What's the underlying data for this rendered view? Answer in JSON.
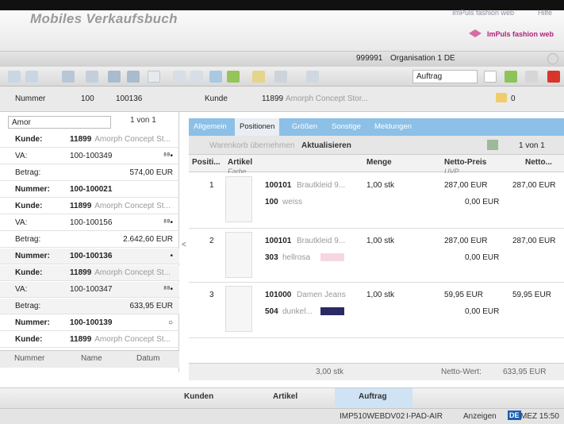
{
  "header": {
    "app_title": "Mobiles Verkaufsbuch",
    "brand_link": "ImPuls fashion web",
    "help_link": "Hilfe",
    "brand_text": "ImPuls fashion web",
    "org_code": "999991",
    "org_name": "Organisation 1 DE"
  },
  "toolbar": {
    "mode_value": "Auftrag"
  },
  "record_header": {
    "nummer_label": "Nummer",
    "nummer_short": "100",
    "nummer_full": "100136",
    "kunde_label": "Kunde",
    "kunde_nr": "11899",
    "kunde_name": "Amorph Concept Stor...",
    "cart_count": "0"
  },
  "left": {
    "search_value": "Amor",
    "pager": "1 von 1",
    "rows": [
      {
        "k": "Kunde:",
        "v": "11899",
        "v2": "Amorph Concept St...",
        "bold": true
      },
      {
        "k": "VA:",
        "v": "100-100349",
        "r": "⁸⁸•"
      },
      {
        "k": "Betrag:",
        "v": "",
        "r": "574,00 EUR"
      },
      {
        "k": "Nummer:",
        "v": "100-100021",
        "bold": true
      },
      {
        "k": "Kunde:",
        "v": "11899",
        "v2": "Amorph Concept St...",
        "bold": true
      },
      {
        "k": "VA:",
        "v": "100-100156",
        "r": "⁸⁸•"
      },
      {
        "k": "Betrag:",
        "v": "",
        "r": "2.642,60 EUR"
      },
      {
        "k": "Nummer:",
        "v": "100-100136",
        "r": "•",
        "bold": true
      },
      {
        "k": "Kunde:",
        "v": "11899",
        "v2": "Amorph Concept St...",
        "bold": true
      },
      {
        "k": "VA:",
        "v": "100-100347",
        "r": "⁸⁸•"
      },
      {
        "k": "Betrag:",
        "v": "",
        "r": "633,95 EUR"
      },
      {
        "k": "Nummer:",
        "v": "100-100139",
        "r": "○",
        "bold": true
      },
      {
        "k": "Kunde:",
        "v": "11899",
        "v2": "Amorph Concept St...",
        "bold": true
      }
    ],
    "sort_tabs": [
      "Nummer",
      "Name",
      "Datum"
    ]
  },
  "tabs": [
    "Allgemein",
    "Positionen",
    "Größen",
    "Sonstige",
    "Meldungen"
  ],
  "subbar": {
    "cart_button": "Warenkorb übernehmen",
    "refresh_button": "Aktualisieren",
    "pager": "1 von 1"
  },
  "columns": {
    "position": "Positi...",
    "artikel": "Artikel",
    "farbe": "Farbe",
    "menge": "Menge",
    "netto_preis": "Netto-Preis",
    "uvp": "UVP",
    "netto": "Netto..."
  },
  "positions": [
    {
      "pos": "1",
      "art_nr": "100101",
      "art_name": "Brautkleid 9...",
      "color_nr": "100",
      "color_name": "weiss",
      "menge": "1,00 stk",
      "preis": "287,00 EUR",
      "uvp": "0,00 EUR",
      "netto": "287,00 EUR",
      "swatch": "#ffffff"
    },
    {
      "pos": "2",
      "art_nr": "100101",
      "art_name": "Brautkleid 9...",
      "color_nr": "303",
      "color_name": "hellrosa",
      "menge": "1,00 stk",
      "preis": "287,00 EUR",
      "uvp": "0,00 EUR",
      "netto": "287,00 EUR",
      "swatch": "#f7d7df"
    },
    {
      "pos": "3",
      "art_nr": "101000",
      "art_name": "Damen Jeans",
      "color_nr": "504",
      "color_name": "dunkel...",
      "menge": "1,00 stk",
      "preis": "59,95 EUR",
      "uvp": "0,00 EUR",
      "netto": "59,95 EUR",
      "swatch": "#2c2a64"
    }
  ],
  "summary": {
    "total_qty": "3,00 stk",
    "netto_label": "Netto-Wert:",
    "netto_value": "633,95 EUR"
  },
  "bottom_nav": [
    "Kunden",
    "Artikel",
    "Auftrag"
  ],
  "status": {
    "host": "IMP510WEBDV02",
    "client": "I-PAD-AIR",
    "show": "Anzeigen",
    "lang": "DE",
    "time": "MEZ 15:50"
  },
  "colors": {
    "accent": "#8cc0e6",
    "brand": "#b0257a"
  }
}
